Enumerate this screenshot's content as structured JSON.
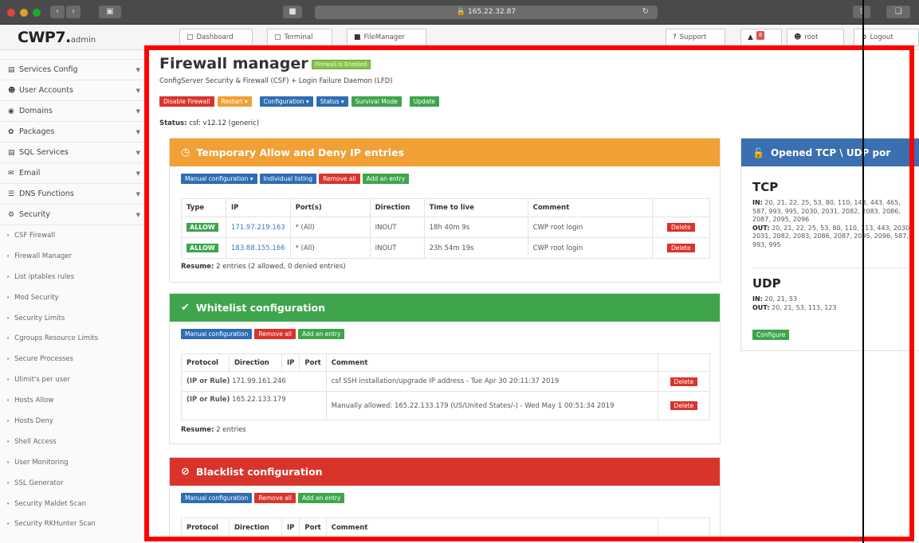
{
  "browser": {
    "url": "165.22.32.87",
    "tabs_icon": "sidebar-icon",
    "back_icon": "back-icon",
    "forward_icon": "forward-icon"
  },
  "topbar": {
    "logo_main": "CWP7.",
    "logo_sub": "admin",
    "nav": [
      {
        "label": "Dashboard",
        "icon": "monitor-icon"
      },
      {
        "label": "Terminal",
        "icon": "terminal-icon"
      },
      {
        "label": "FileManager",
        "icon": "folder-icon"
      },
      {
        "label": "Support",
        "icon": "question-icon"
      },
      {
        "label": "8",
        "icon": "bell-icon"
      },
      {
        "label": "root",
        "icon": "user-icon"
      },
      {
        "label": "Logout",
        "icon": "logout-icon"
      }
    ]
  },
  "sidebar": {
    "heads": [
      {
        "label": "Services Config",
        "icon": "server-icon"
      },
      {
        "label": "User Accounts",
        "icon": "user-icon"
      },
      {
        "label": "Domains",
        "icon": "globe-icon"
      },
      {
        "label": "Packages",
        "icon": "package-icon"
      },
      {
        "label": "SQL Services",
        "icon": "database-icon"
      },
      {
        "label": "Email",
        "icon": "email-icon"
      },
      {
        "label": "DNS Functions",
        "icon": "dns-icon"
      },
      {
        "label": "Security",
        "icon": "shield-icon"
      }
    ],
    "security_items": [
      "CSF Firewall",
      "Firewall Manager",
      "List iptables rules",
      "Mod Security",
      "Security Limits",
      "Cgroups Resource Limits",
      "Secure Processes",
      "Ulimit's per user",
      "Hosts Allow",
      "Hosts Deny",
      "Shell Access",
      "User Monitoring",
      "SSL Generator",
      "Security Maldet Scan",
      "Security RKHunter Scan"
    ]
  },
  "main": {
    "title": "Firewall manager",
    "enabled_label": "Firewall is Enabled",
    "subtitle": "ConfigServer Security & Firewall (CSF) + Login Failure Daemon (LFD)",
    "actions": [
      {
        "label": "Disable Firewall",
        "color": "#d9342b"
      },
      {
        "label": "Restart ▾",
        "color": "#f0a035"
      },
      {
        "label": "Configuration ▾",
        "color": "#2e6db4"
      },
      {
        "label": "Status ▾",
        "color": "#2e6db4"
      },
      {
        "label": "Survival Mode",
        "color": "#3fa54d"
      },
      {
        "label": "Update",
        "color": "#3fa54d"
      }
    ],
    "status_label": "Status:",
    "status_value": "csf: v12.12 (generic)"
  },
  "temp_panel": {
    "title": "Temporary Allow and Deny IP entries",
    "color": "#f0a035",
    "tools": [
      {
        "label": "Manual configuration ▾",
        "color": "#2e6db4"
      },
      {
        "label": "Individual listing",
        "color": "#2e6db4"
      },
      {
        "label": "Remove all",
        "color": "#d9342b"
      },
      {
        "label": "Add an entry",
        "color": "#3fa54d"
      }
    ],
    "columns": [
      "Type",
      "IP",
      "Port(s)",
      "Direction",
      "Time to live",
      "Comment",
      ""
    ],
    "rows": [
      {
        "type": "ALLOW",
        "ip": "171.97.219.163",
        "ports": "* (All)",
        "direction": "INOUT",
        "ttl": "18h 40m 9s",
        "comment": "CWP root login",
        "action": "Delete"
      },
      {
        "type": "ALLOW",
        "ip": "183.88.155.166",
        "ports": "* (All)",
        "direction": "INOUT",
        "ttl": "23h 54m 19s",
        "comment": "CWP root login",
        "action": "Delete"
      }
    ],
    "resume_label": "Resume:",
    "resume_text": "2 entries (2 allowed, 0 denied entries)"
  },
  "white_panel": {
    "title": "Whitelist configuration",
    "color": "#3fa54d",
    "tools": [
      {
        "label": "Manual configuration",
        "color": "#2e6db4"
      },
      {
        "label": "Remove all",
        "color": "#d9342b"
      },
      {
        "label": "Add an entry",
        "color": "#3fa54d"
      }
    ],
    "columns": [
      "Protocol",
      "Direction",
      "IP",
      "Port",
      "Comment",
      ""
    ],
    "rows": [
      {
        "rule": "(IP or Rule)",
        "ip": "171.99.161.246",
        "comment": "csf SSH installation/upgrade IP address - Tue Apr 30 20:11:37 2019",
        "action": "Delete"
      },
      {
        "rule": "(IP or Rule)",
        "ip": "165.22.133.179",
        "comment": "Manually allowed: 165.22.133.179 (US/United States/-) - Wed May 1 00:51:34 2019",
        "action": "Delete"
      }
    ],
    "resume_label": "Resume:",
    "resume_text": "2 entries"
  },
  "black_panel": {
    "title": "Blacklist configuration",
    "color": "#d9342b",
    "tools": [
      {
        "label": "Manual configuration",
        "color": "#2e6db4"
      },
      {
        "label": "Remove all",
        "color": "#d9342b"
      },
      {
        "label": "Add an entry",
        "color": "#3fa54d"
      }
    ],
    "columns": [
      "Protocol",
      "Direction",
      "IP",
      "Port",
      "Comment",
      ""
    ]
  },
  "ports_panel": {
    "title": "Opened TCP \\ UDP por",
    "tcp_title": "TCP",
    "tcp_in_label": "IN:",
    "tcp_in": "20, 21, 22, 25, 53, 80, 110, 143, 443, 465, 587, 993, 995, 2030, 2031, 2082, 2083, 2086, 2087, 2095, 2096",
    "tcp_out_label": "OUT:",
    "tcp_out": "20, 21, 22, 25, 53, 80, 110, 113, 443, 2030, 2031, 2082, 2083, 2086, 2087, 2095, 2096, 587, 993, 995",
    "udp_title": "UDP",
    "udp_in_label": "IN:",
    "udp_in": "20, 21, 53",
    "udp_out_label": "OUT:",
    "udp_out": "20, 21, 53, 113, 123",
    "configure": "Configure"
  }
}
